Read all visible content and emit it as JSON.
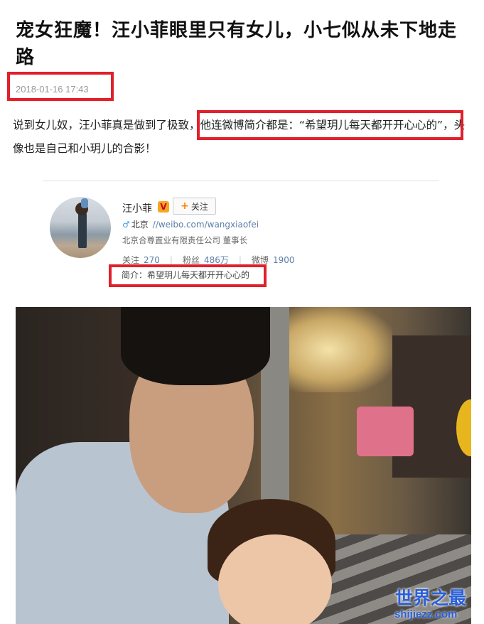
{
  "article": {
    "title": "宠女狂魔！汪小菲眼里只有女儿，小七似从未下地走路",
    "date": "2018-01-16 17:43",
    "paragraph": "说到女儿奴，汪小菲真是做到了极致，他连微博简介都是：“希望玥儿每天都开开心心的”，头像也是自己和小玥儿的合影！"
  },
  "weibo_card": {
    "name": "汪小菲",
    "verified_badge": "V",
    "follow_label": "关注",
    "location": "北京",
    "url": "//weibo.com/wangxiaofei",
    "company": "北京合尊置业有限责任公司 董事长",
    "stats": [
      {
        "label": "关注",
        "value": "270"
      },
      {
        "label": "粉丝",
        "value": "486万"
      },
      {
        "label": "微博",
        "value": "1900"
      }
    ],
    "intro": "简介：希望玥儿每天都开开心心的"
  },
  "watermark": {
    "title": "世界之最",
    "site": "shijiezz.com"
  },
  "colors": {
    "highlight_box": "#e0202a",
    "link_blue": "#5d7ea5",
    "follow_plus": "#ff8200",
    "watermark": "#2a5fd8"
  }
}
